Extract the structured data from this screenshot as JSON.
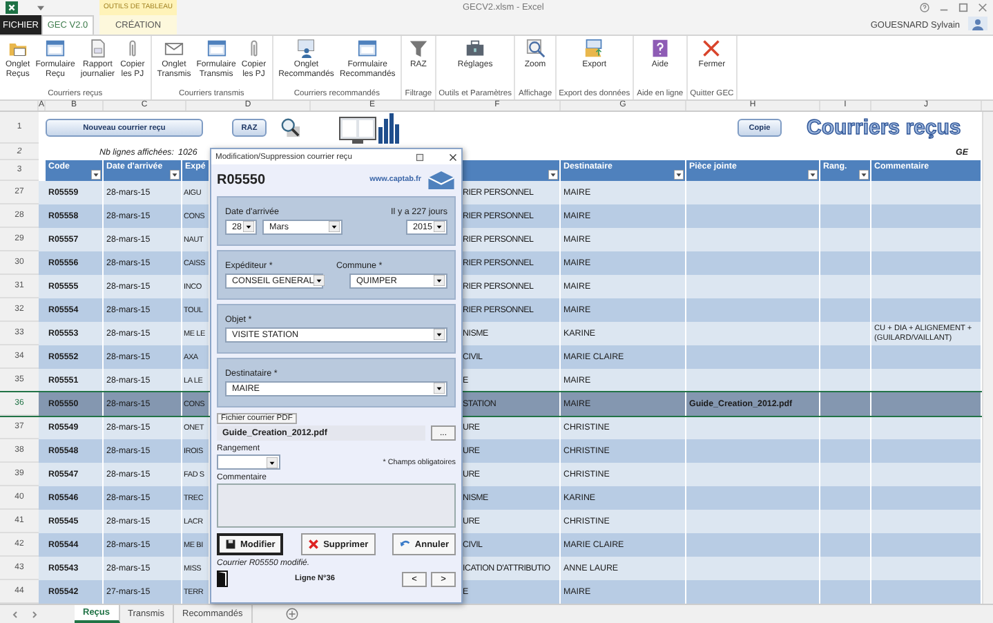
{
  "window": {
    "title": "GECV2.xlsm - Excel",
    "user": "GOUESNARD Sylvain"
  },
  "ribbon_tabs": [
    {
      "label": "FICHIER",
      "kind": "file",
      "selected": false
    },
    {
      "label": "GEC V2.0",
      "kind": "tab",
      "selected": true
    },
    {
      "label": "CRÉATION",
      "kind": "context",
      "context": "OUTILS DE TABLEAU",
      "selected": false
    }
  ],
  "ribbon_groups": [
    {
      "label": "Courriers reçus",
      "buttons": [
        {
          "label": "Onglet\nReçus",
          "kind": "folder"
        },
        {
          "label": "Formulaire\nReçu",
          "kind": "form"
        },
        {
          "label": "Rapport\njournalier",
          "kind": "report"
        },
        {
          "label": "Copier\nles PJ",
          "kind": "clip"
        }
      ]
    },
    {
      "label": "Courriers transmis",
      "buttons": [
        {
          "label": "Onglet\nTransmis",
          "kind": "envelope"
        },
        {
          "label": "Formulaire\nTransmis",
          "kind": "form"
        },
        {
          "label": "Copier\nles PJ",
          "kind": "clip"
        }
      ]
    },
    {
      "label": "Courriers recommandés",
      "buttons": [
        {
          "label": "Onglet\nRecommandés",
          "kind": "people"
        },
        {
          "label": "Formulaire\nRecommandés",
          "kind": "form"
        }
      ]
    },
    {
      "label": "Filtrage",
      "buttons": [
        {
          "label": "RAZ",
          "kind": "funnel"
        }
      ]
    },
    {
      "label": "Outils et Paramètres",
      "buttons": [
        {
          "label": "Réglages",
          "kind": "toolbox"
        }
      ]
    },
    {
      "label": "Affichage",
      "buttons": [
        {
          "label": "Zoom",
          "kind": "zoom"
        }
      ]
    },
    {
      "label": "Export des données",
      "buttons": [
        {
          "label": "Export",
          "kind": "export"
        }
      ]
    },
    {
      "label": "Aide en ligne",
      "buttons": [
        {
          "label": "Aide",
          "kind": "help"
        }
      ]
    },
    {
      "label": "Quitter GEC",
      "buttons": [
        {
          "label": "Fermer",
          "kind": "close"
        }
      ]
    }
  ],
  "column_letters": [
    "A",
    "B",
    "C",
    "D",
    "E",
    "F",
    "G",
    "H",
    "I",
    "J"
  ],
  "sheet": {
    "row_numbers": [
      "1",
      "2",
      "3"
    ],
    "new_button": "Nouveau courrier reçu",
    "raz_button": "RAZ",
    "copy_button": "Copie",
    "heading": "Courriers reçus",
    "count_label": "Nb lignes affichées:",
    "count": "1026",
    "corner_text": "GE"
  },
  "table": {
    "columns": [
      {
        "label": "Code",
        "filter": true
      },
      {
        "label": "Date d'arrivée",
        "filter": true
      },
      {
        "label": "Expé",
        "filter": false
      },
      {
        "filter": true
      },
      {
        "label": "Destinataire",
        "filter": true
      },
      {
        "label": "Pièce jointe",
        "filter": true
      },
      {
        "label": "Rang.",
        "filter": true
      },
      {
        "label": "Commentaire",
        "filter": false
      }
    ],
    "rows": [
      {
        "number": "27",
        "code": "R05559",
        "date": "28-mars-15",
        "sender": "AIGU",
        "subject": "RIER PERSONNEL",
        "recipient": "MAIRE",
        "selected": false
      },
      {
        "number": "28",
        "code": "R05558",
        "date": "28-mars-15",
        "sender": "CONS",
        "subject": "RIER PERSONNEL",
        "recipient": "MAIRE",
        "selected": false
      },
      {
        "number": "29",
        "code": "R05557",
        "date": "28-mars-15",
        "sender": "NAUT",
        "subject": "RIER PERSONNEL",
        "recipient": "MAIRE",
        "selected": false
      },
      {
        "number": "30",
        "code": "R05556",
        "date": "28-mars-15",
        "sender": "CAISS",
        "subject": "RIER PERSONNEL",
        "recipient": "MAIRE",
        "selected": false
      },
      {
        "number": "31",
        "code": "R05555",
        "date": "28-mars-15",
        "sender": "INCO",
        "subject": "RIER PERSONNEL",
        "recipient": "MAIRE",
        "selected": false
      },
      {
        "number": "32",
        "code": "R05554",
        "date": "28-mars-15",
        "sender": "TOUL",
        "subject": "RIER PERSONNEL",
        "recipient": "MAIRE",
        "selected": false
      },
      {
        "number": "33",
        "code": "R05553",
        "date": "28-mars-15",
        "sender": "ME LE",
        "subject": "NISME",
        "recipient": "KARINE",
        "comment": "CU + DIA + ALIGNEMENT + (GUILARD/VAILLANT)",
        "selected": false
      },
      {
        "number": "34",
        "code": "R05552",
        "date": "28-mars-15",
        "sender": "AXA",
        "subject": "CIVIL",
        "recipient": "MARIE CLAIRE",
        "selected": false
      },
      {
        "number": "35",
        "code": "R05551",
        "date": "28-mars-15",
        "sender": "LA LE",
        "subject": "E",
        "recipient": "MAIRE",
        "selected": false
      },
      {
        "number": "36",
        "code": "R05550",
        "date": "28-mars-15",
        "sender": "CONS",
        "subject": "STATION",
        "recipient": "MAIRE",
        "attachment": "Guide_Creation_2012.pdf",
        "selected": true
      },
      {
        "number": "37",
        "code": "R05549",
        "date": "28-mars-15",
        "sender": "ONET",
        "subject": "URE",
        "recipient": "CHRISTINE",
        "selected": false
      },
      {
        "number": "38",
        "code": "R05548",
        "date": "28-mars-15",
        "sender": "IROIS",
        "subject": "URE",
        "recipient": "CHRISTINE",
        "selected": false
      },
      {
        "number": "39",
        "code": "R05547",
        "date": "28-mars-15",
        "sender": "FAD S",
        "subject": "URE",
        "recipient": "CHRISTINE",
        "selected": false
      },
      {
        "number": "40",
        "code": "R05546",
        "date": "28-mars-15",
        "sender": "TREC",
        "subject": "NISME",
        "recipient": "KARINE",
        "selected": false
      },
      {
        "number": "41",
        "code": "R05545",
        "date": "28-mars-15",
        "sender": "LACR",
        "subject": "URE",
        "recipient": "CHRISTINE",
        "selected": false
      },
      {
        "number": "42",
        "code": "R05544",
        "date": "28-mars-15",
        "sender": "ME BI",
        "subject": "CIVIL",
        "recipient": "MARIE CLAIRE",
        "selected": false
      },
      {
        "number": "43",
        "code": "R05543",
        "date": "28-mars-15",
        "sender": "MISS",
        "subject": "ICATION D'ATTRIBUTIO",
        "recipient": "ANNE LAURE",
        "selected": false
      },
      {
        "number": "44",
        "code": "R05542",
        "date": "27-mars-15",
        "sender": "TERR",
        "subject": "E",
        "recipient": "MAIRE",
        "selected": false
      }
    ]
  },
  "dialog": {
    "title": "Modification/Suppression courrier reçu",
    "record": "R05550",
    "link": "www.captab.fr",
    "date_label": "Date d'arrivée",
    "age": "Il y a 227 jours",
    "day": "28",
    "month": "Mars",
    "year": "2015",
    "sender_label": "Expéditeur *",
    "sender": "CONSEIL GENERAL",
    "town_label": "Commune *",
    "town": "QUIMPER",
    "subject_label": "Objet *",
    "subject": "VISITE STATION",
    "recipient_label": "Destinataire *",
    "recipient": "MAIRE",
    "file_label": "Fichier courrier PDF",
    "file": "Guide_Creation_2012.pdf",
    "browse": "...",
    "storage_label": "Rangement",
    "required_note": "* Champs obligatoires",
    "comment_label": "Commentaire",
    "buttons": [
      {
        "label": "Modifier",
        "kind": "save"
      },
      {
        "label": "Supprimer",
        "kind": "delete"
      },
      {
        "label": "Annuler",
        "kind": "cancel"
      }
    ],
    "status": "Courrier R05550 modifié.",
    "line": "Ligne N°36",
    "prev": "<",
    "next": ">"
  },
  "sheet_tabs": [
    {
      "label": "Reçus",
      "selected": true
    },
    {
      "label": "Transmis",
      "selected": false
    },
    {
      "label": "Recommandés",
      "selected": false
    }
  ]
}
